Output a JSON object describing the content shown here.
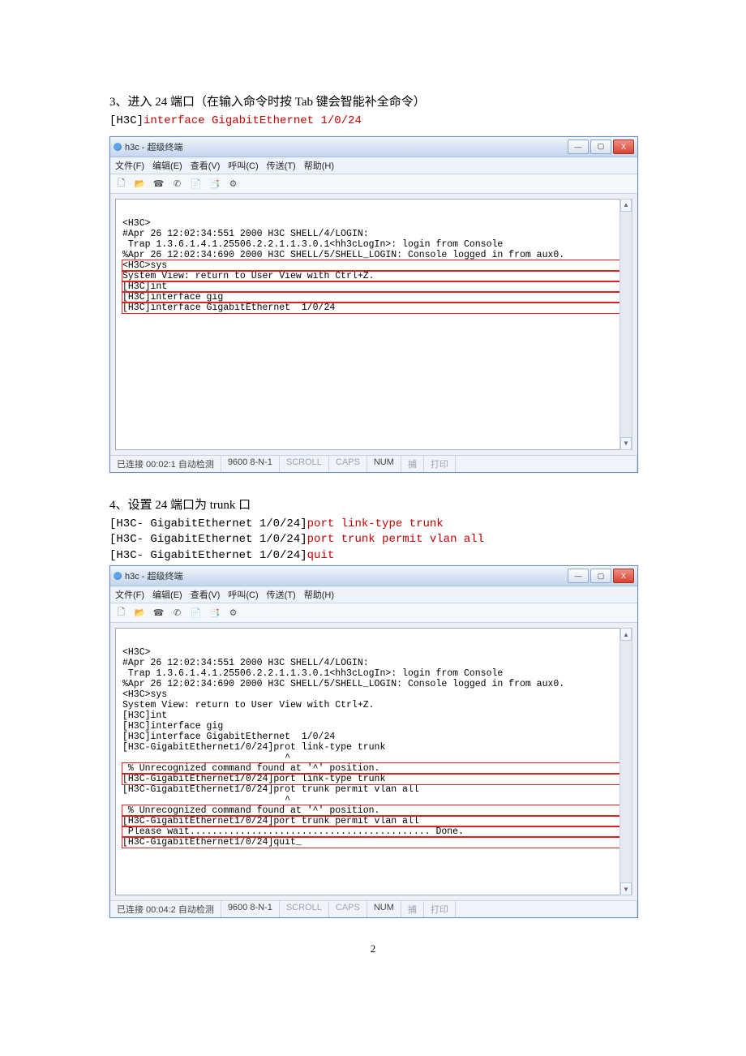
{
  "step3": {
    "heading": "3、进入 24 端口（在输入命令时按 Tab 键会智能补全命令）",
    "cmd_prompt": "[H3C]",
    "cmd_text": "interface GigabitEthernet 1/0/24"
  },
  "step4": {
    "heading": "4、设置 24 端口为 trunk 口",
    "lines": [
      {
        "prompt": "[H3C- GigabitEthernet 1/0/24]",
        "cmd": "port link-type trunk"
      },
      {
        "prompt": "[H3C- GigabitEthernet 1/0/24]",
        "cmd": "port trunk permit vlan all"
      },
      {
        "prompt": "[H3C- GigabitEthernet 1/0/24]",
        "cmd": "quit"
      }
    ]
  },
  "window": {
    "title": "h3c - 超级终端",
    "menu": [
      "文件(F)",
      "编辑(E)",
      "查看(V)",
      "呼叫(C)",
      "传送(T)",
      "帮助(H)"
    ],
    "min": "—",
    "max": "▢",
    "close": "X"
  },
  "terminal1": {
    "lines": [
      "<H3C>",
      "#Apr 26 12:02:34:551 2000 H3C SHELL/4/LOGIN:",
      " Trap 1.3.6.1.4.1.25506.2.2.1.1.3.0.1<hh3cLogIn>: login from Console",
      "%Apr 26 12:02:34:690 2000 H3C SHELL/5/SHELL_LOGIN: Console logged in from aux0.",
      "<H3C>sys",
      "System View: return to User View with Ctrl+Z.",
      "[H3C]int",
      "[H3C]interface gig",
      "[H3C]interface GigabitEthernet  1/0/24"
    ],
    "hl_start": 4,
    "hl_end": 8
  },
  "terminal2": {
    "lines": [
      "<H3C>",
      "#Apr 26 12:02:34:551 2000 H3C SHELL/4/LOGIN:",
      " Trap 1.3.6.1.4.1.25506.2.2.1.1.3.0.1<hh3cLogIn>: login from Console",
      "%Apr 26 12:02:34:690 2000 H3C SHELL/5/SHELL_LOGIN: Console logged in from aux0.",
      "<H3C>sys",
      "System View: return to User View with Ctrl+Z.",
      "[H3C]int",
      "[H3C]interface gig",
      "[H3C]interface GigabitEthernet  1/0/24",
      "[H3C-GigabitEthernet1/0/24]prot link-type trunk",
      "                             ^",
      " % Unrecognized command found at '^' position.",
      "[H3C-GigabitEthernet1/0/24]port link-type trunk",
      "[H3C-GigabitEthernet1/0/24]prot trunk permit vlan all",
      "                             ^",
      " % Unrecognized command found at '^' position.",
      "[H3C-GigabitEthernet1/0/24]port trunk permit vlan all",
      " Please wait........................................... Done.",
      "[H3C-GigabitEthernet1/0/24]quit_"
    ],
    "hl_groups": [
      {
        "start": 11,
        "end": 12
      },
      {
        "start": 15,
        "end": 18
      }
    ]
  },
  "status1": {
    "conn": "已连接 00:02:1 自动检测",
    "baud": "9600 8-N-1",
    "scroll": "SCROLL",
    "caps": "CAPS",
    "num": "NUM",
    "capt": "捕",
    "print": "打印"
  },
  "status2": {
    "conn": "已连接 00:04:2 自动检测",
    "baud": "9600 8-N-1",
    "scroll": "SCROLL",
    "caps": "CAPS",
    "num": "NUM",
    "capt": "捕",
    "print": "打印"
  },
  "page_number": "2"
}
